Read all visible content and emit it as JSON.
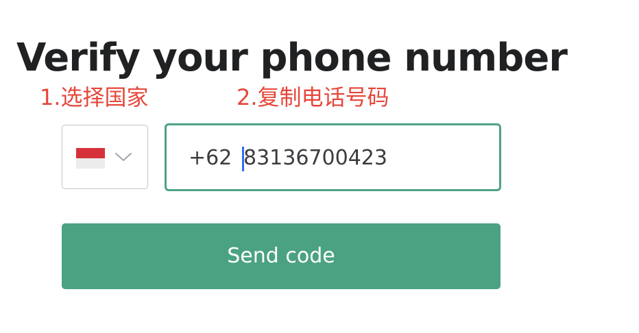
{
  "header": {
    "title": "Verify your phone number"
  },
  "annotations": {
    "step1": "1.选择国家",
    "step2": "2.复制电话号码",
    "color": "#e5473a"
  },
  "country_select": {
    "selected_flag": "indonesia-flag",
    "icon": "chevron-down-icon"
  },
  "phone_input": {
    "prefix": "+62",
    "value": "83136700423"
  },
  "actions": {
    "send_label": "Send code"
  },
  "colors": {
    "accent": "#4ba282",
    "input_border": "#4da283",
    "title": "#202123",
    "caret": "#2f6cf0"
  }
}
